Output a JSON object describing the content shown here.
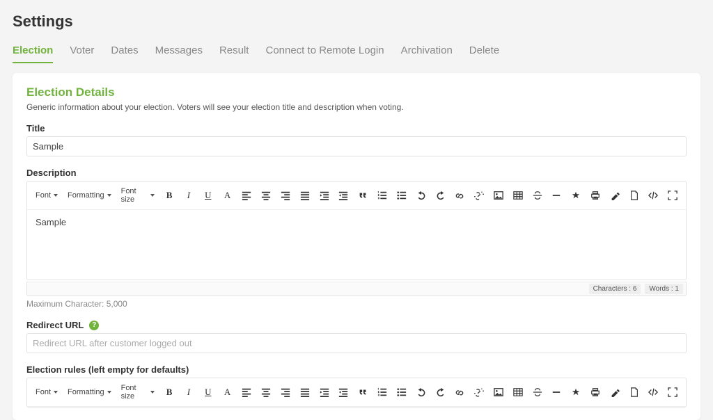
{
  "page": {
    "title": "Settings"
  },
  "tabs": {
    "election": "Election",
    "voter": "Voter",
    "dates": "Dates",
    "messages": "Messages",
    "result": "Result",
    "remote": "Connect to Remote Login",
    "archivation": "Archivation",
    "delete": "Delete"
  },
  "section": {
    "title": "Election Details",
    "desc": "Generic information about your election. Voters will see your election title and description when voting."
  },
  "titleField": {
    "label": "Title",
    "value": "Sample"
  },
  "descField": {
    "label": "Description",
    "value": "Sample",
    "maxHint": "Maximum Character: 5,000",
    "chars": "Characters : 6",
    "words": "Words : 1"
  },
  "redirect": {
    "label": "Redirect URL",
    "placeholder": "Redirect URL after customer logged out"
  },
  "rules": {
    "label": "Election rules (left empty for defaults)"
  },
  "toolbar": {
    "font": "Font",
    "formatting": "Formatting",
    "fontsize": "Font size",
    "bold": "B",
    "italic": "I",
    "underline": "U",
    "color": "A"
  }
}
